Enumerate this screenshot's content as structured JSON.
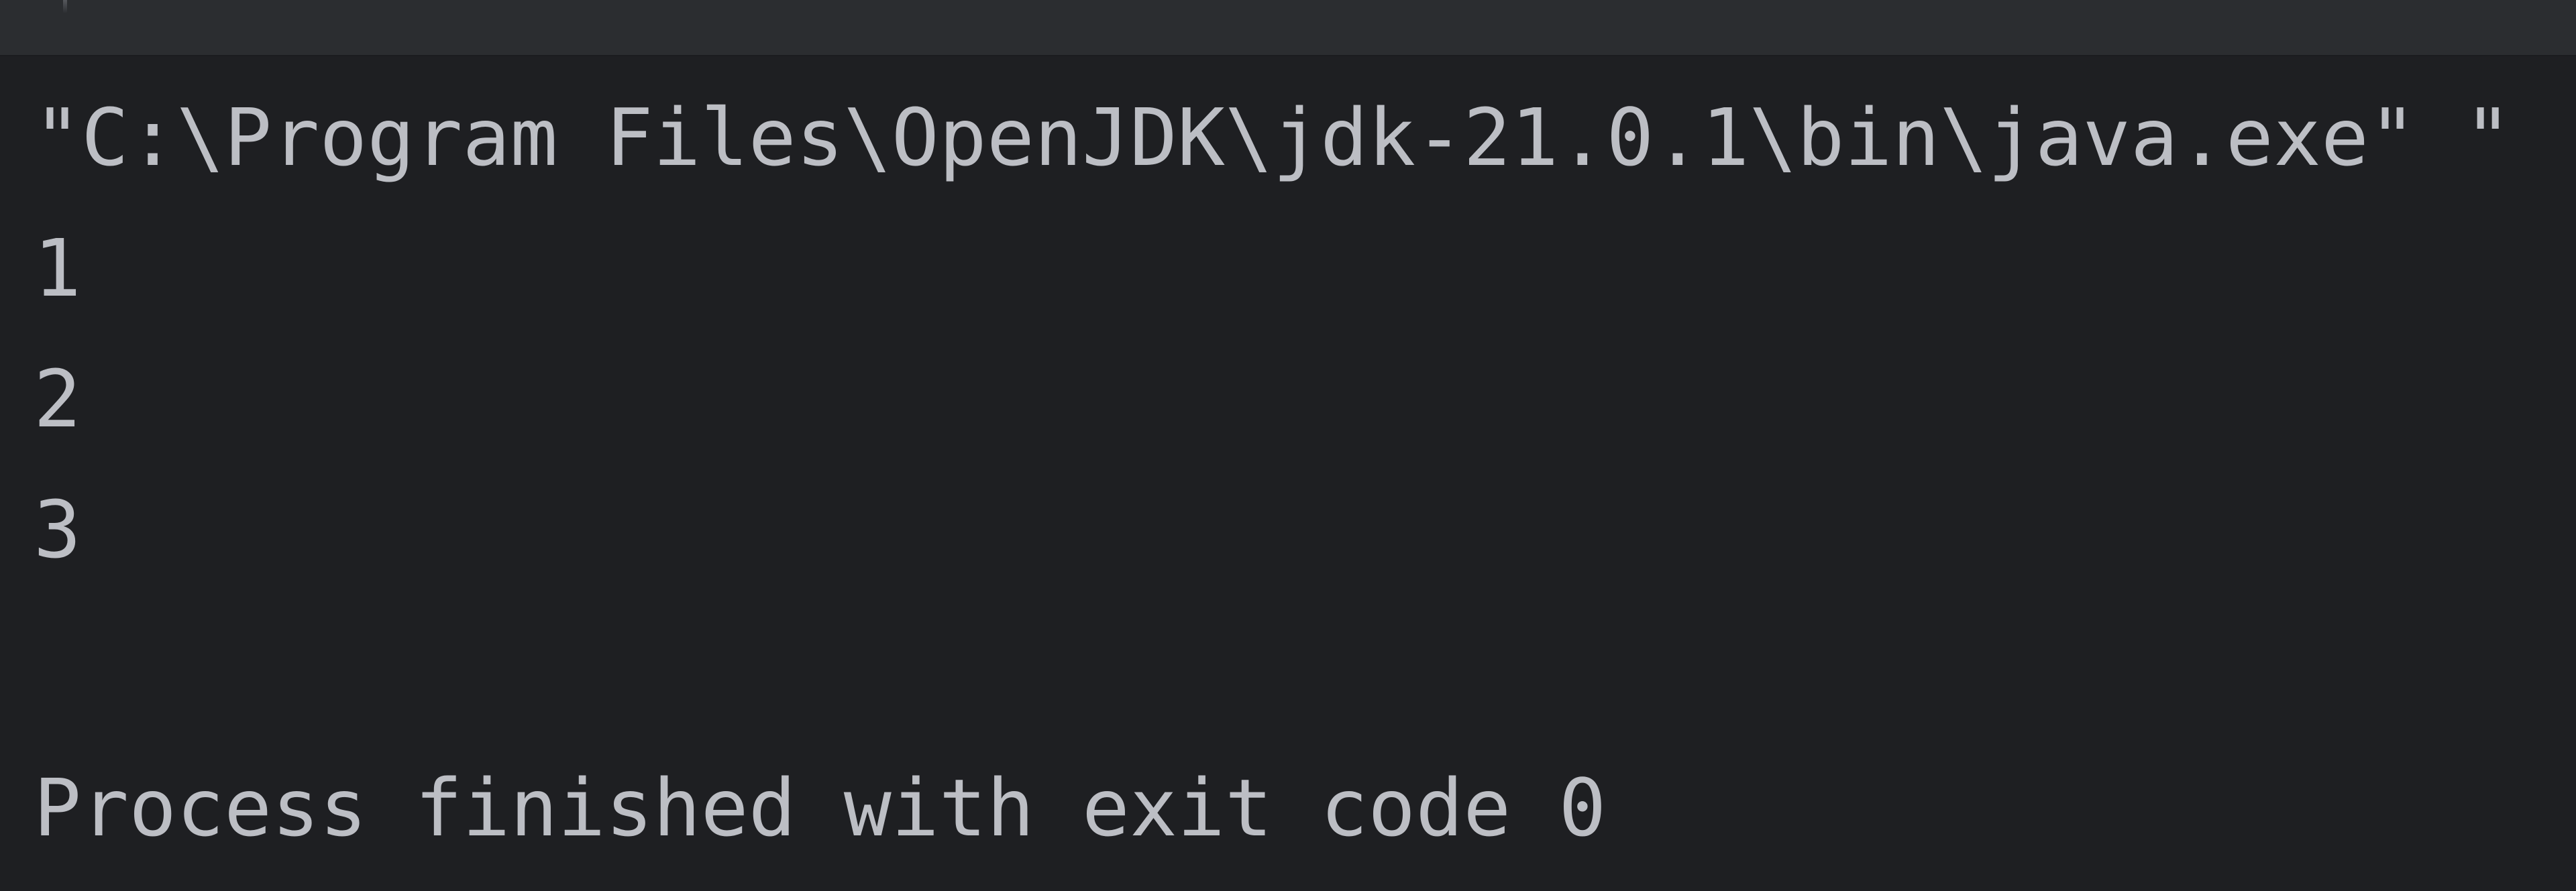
{
  "toolbar": {
    "divider": "tab-divider"
  },
  "console": {
    "lines": [
      "\"C:\\Program Files\\OpenJDK\\jdk-21.0.1\\bin\\java.exe\" \"",
      "1",
      "2",
      "3",
      "",
      "Process finished with exit code 0"
    ]
  },
  "colors": {
    "toolbar_bg": "#2b2d30",
    "console_bg": "#1e1f22",
    "text": "#bcbec4"
  }
}
